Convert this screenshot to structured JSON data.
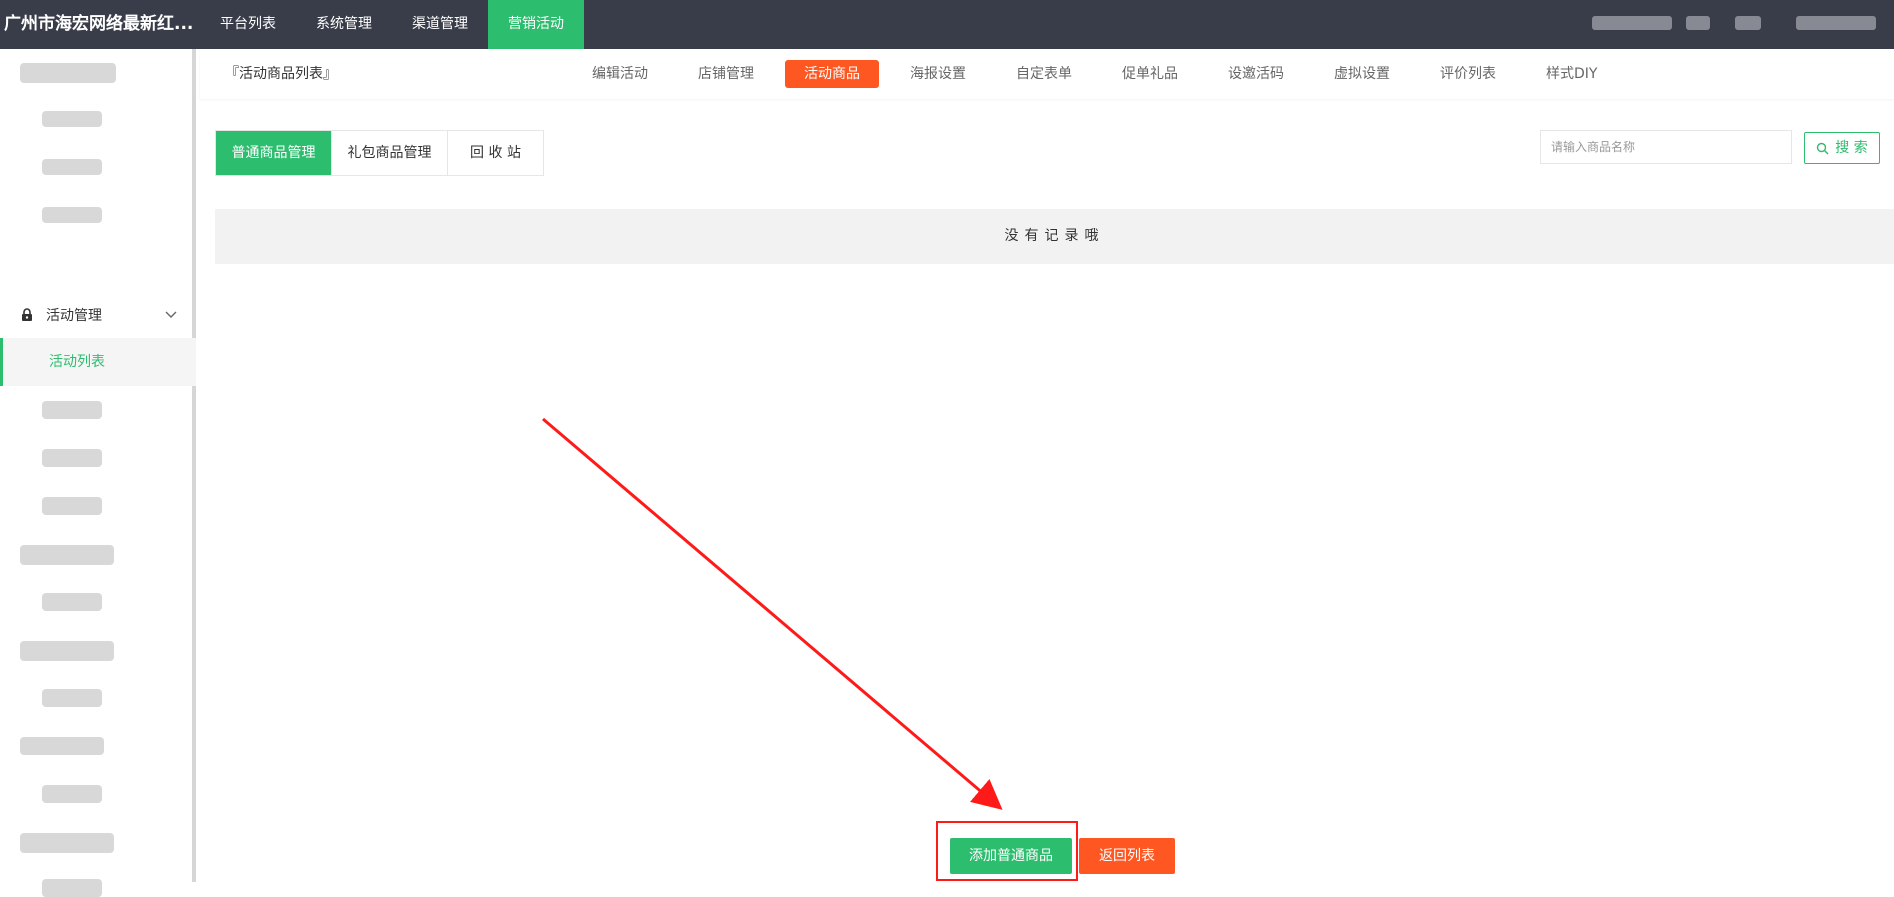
{
  "app": {
    "brand": "广州市海宏网络最新红..."
  },
  "topnav": {
    "items": [
      "平台列表",
      "系统管理",
      "渠道管理",
      "营销活动"
    ],
    "active_index": 3
  },
  "sidebar": {
    "group_label": "活动管理",
    "group_icon": "lock-icon",
    "active_item": "活动列表"
  },
  "subheader": {
    "breadcrumb": "『活动商品列表』",
    "tabs": [
      "编辑活动",
      "店铺管理",
      "活动商品",
      "海报设置",
      "自定表单",
      "促单礼品",
      "设邀活码",
      "虚拟设置",
      "评价列表",
      "样式DIY"
    ],
    "active_tab": "活动商品"
  },
  "content": {
    "category_tabs": [
      "普通商品管理",
      "礼包商品管理",
      "回 收 站"
    ],
    "search": {
      "placeholder": "请输入商品名称",
      "button_label": "搜 索"
    },
    "empty_message": "没有记录哦",
    "add_button": "添加普通商品",
    "back_button": "返回列表"
  },
  "colors": {
    "topbar": "#393d49",
    "primary_green": "#2dbd6e",
    "accent_orange": "#ff5722",
    "annotation_red": "#ff1a1a"
  }
}
